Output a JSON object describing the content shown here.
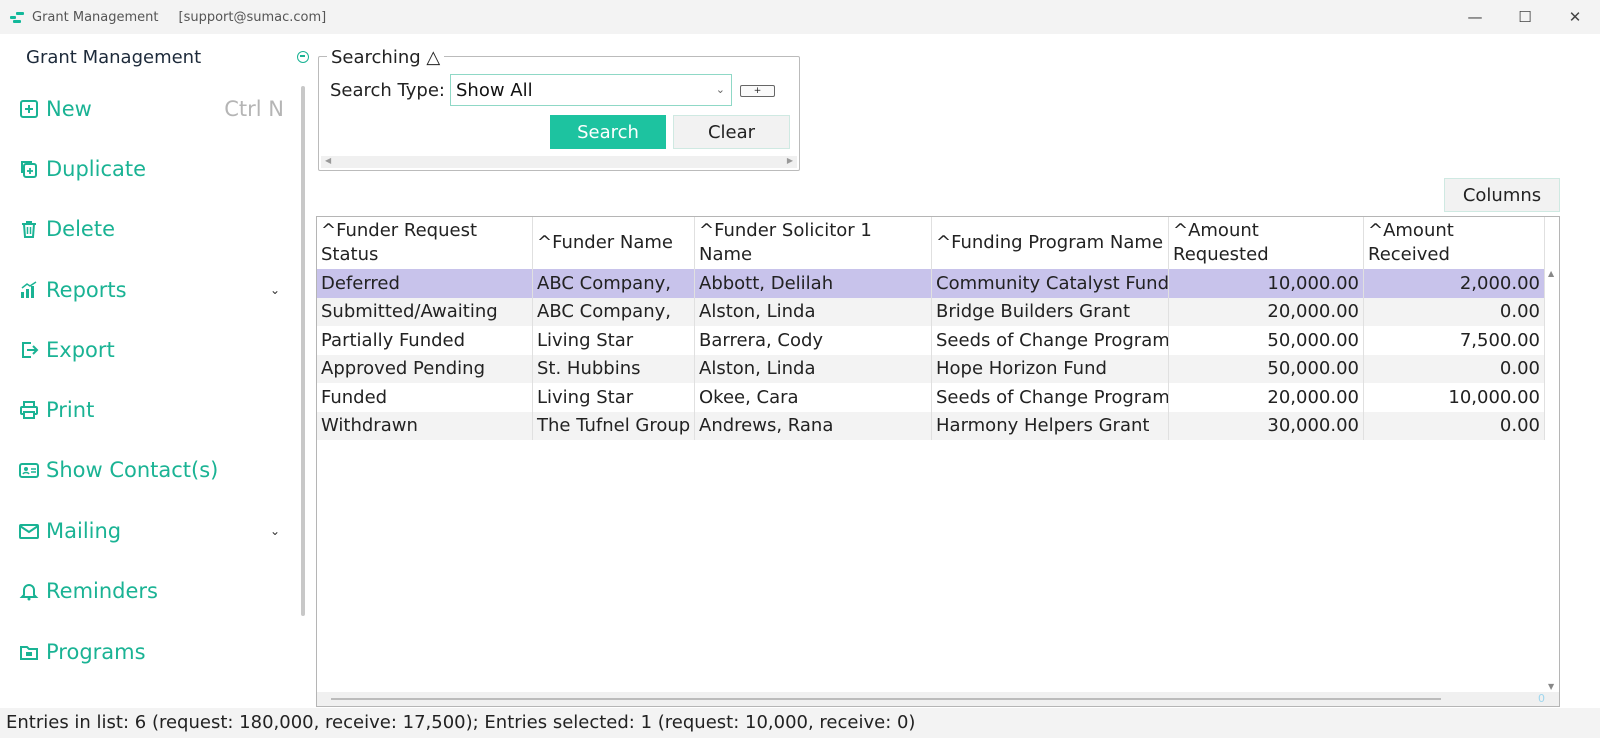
{
  "window": {
    "title": "Grant Management",
    "email": "[support@sumac.com]",
    "minimize": "—",
    "maximize": "☐",
    "close": "✕"
  },
  "sidebar": {
    "heading": "Grant Management",
    "items": [
      {
        "label": "New",
        "shortcut": "Ctrl N",
        "icon": "plus-square-icon"
      },
      {
        "label": "Duplicate",
        "icon": "duplicate-icon"
      },
      {
        "label": "Delete",
        "icon": "trash-icon"
      },
      {
        "label": "Reports",
        "icon": "bar-chart-icon",
        "chevron": "⌄"
      },
      {
        "label": "Export",
        "icon": "export-icon"
      },
      {
        "label": "Print",
        "icon": "printer-icon"
      },
      {
        "label": "Show Contact(s)",
        "icon": "contact-card-icon"
      },
      {
        "label": "Mailing",
        "icon": "mail-icon",
        "chevron": "⌄"
      },
      {
        "label": "Reminders",
        "icon": "bell-icon"
      },
      {
        "label": "Programs",
        "icon": "folder-icon"
      }
    ]
  },
  "search": {
    "legend": "Searching △",
    "type_label": "Search Type:",
    "type_value": "Show All",
    "add_label": "+",
    "search_button": "Search",
    "clear_button": "Clear"
  },
  "columns_button": "Columns",
  "table": {
    "headers": [
      "^Funder Request Status",
      "^Funder Name",
      "^Funder Solicitor 1 Name",
      "^Funding Program Name",
      "^Amount Requested",
      "^Amount Received"
    ],
    "rows": [
      [
        "Deferred",
        "ABC Company,",
        "Abbott, Delilah",
        "Community Catalyst Fund",
        "10,000.00",
        "2,000.00"
      ],
      [
        "Submitted/Awaiting",
        "ABC Company,",
        "Alston, Linda",
        "Bridge Builders Grant",
        "20,000.00",
        "0.00"
      ],
      [
        "Partially Funded",
        "Living Star",
        "Barrera, Cody",
        "Seeds of Change Program",
        "50,000.00",
        "7,500.00"
      ],
      [
        "Approved Pending",
        "St. Hubbins",
        "Alston, Linda",
        "Hope Horizon Fund",
        "50,000.00",
        "0.00"
      ],
      [
        "Funded",
        "Living Star",
        "Okee, Cara",
        "Seeds of Change Program",
        "20,000.00",
        "10,000.00"
      ],
      [
        "Withdrawn",
        "The Tufnel Group",
        "Andrews, Rana",
        "Harmony Helpers Grant",
        "30,000.00",
        "0.00"
      ]
    ],
    "selected_row": 0,
    "corner_value": "0"
  },
  "status": "Entries in list: 6 (request: 180,000, receive: 17,500); Entries selected: 1 (request: 10,000, receive: 0)",
  "colors": {
    "accent": "#1ab394",
    "selection": "#c8c3eb"
  }
}
